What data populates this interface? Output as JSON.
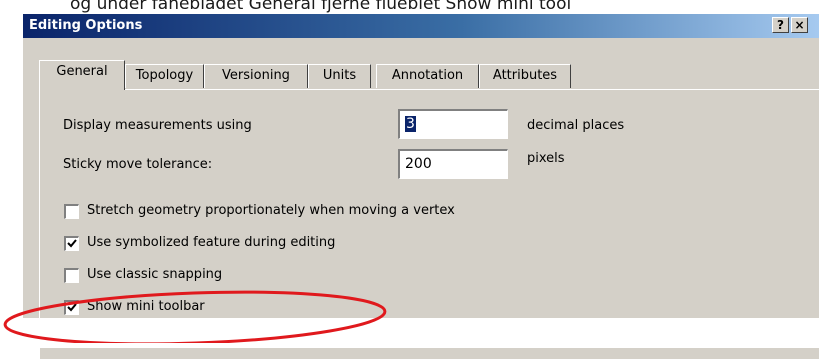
{
  "background_text": "og under fanebladet General fjerne flueblet Show mini tool",
  "dialog": {
    "title": "Editing Options",
    "help_button": "?",
    "close_button": "×"
  },
  "tabs": [
    {
      "label": "General",
      "active": true
    },
    {
      "label": "Topology",
      "active": false
    },
    {
      "label": "Versioning",
      "active": false
    },
    {
      "label": "Units",
      "active": false
    },
    {
      "label": "Annotation",
      "active": false
    },
    {
      "label": "Attributes",
      "active": false
    }
  ],
  "fields": {
    "display_measurements": {
      "label": "Display measurements using",
      "value": "3",
      "suffix": "decimal places"
    },
    "sticky_move": {
      "label": "Sticky move tolerance:",
      "value": "200",
      "suffix": "pixels"
    }
  },
  "checkboxes": [
    {
      "label": "Stretch geometry proportionately when moving a vertex",
      "checked": false
    },
    {
      "label": "Use symbolized feature during editing",
      "checked": true
    },
    {
      "label": "Use classic snapping",
      "checked": false
    },
    {
      "label": "Show mini toolbar",
      "checked": true
    }
  ],
  "colors": {
    "title_bar": "#0a246a",
    "dialog_face": "#d4d0c8",
    "annotation_circle": "#e0191d"
  }
}
